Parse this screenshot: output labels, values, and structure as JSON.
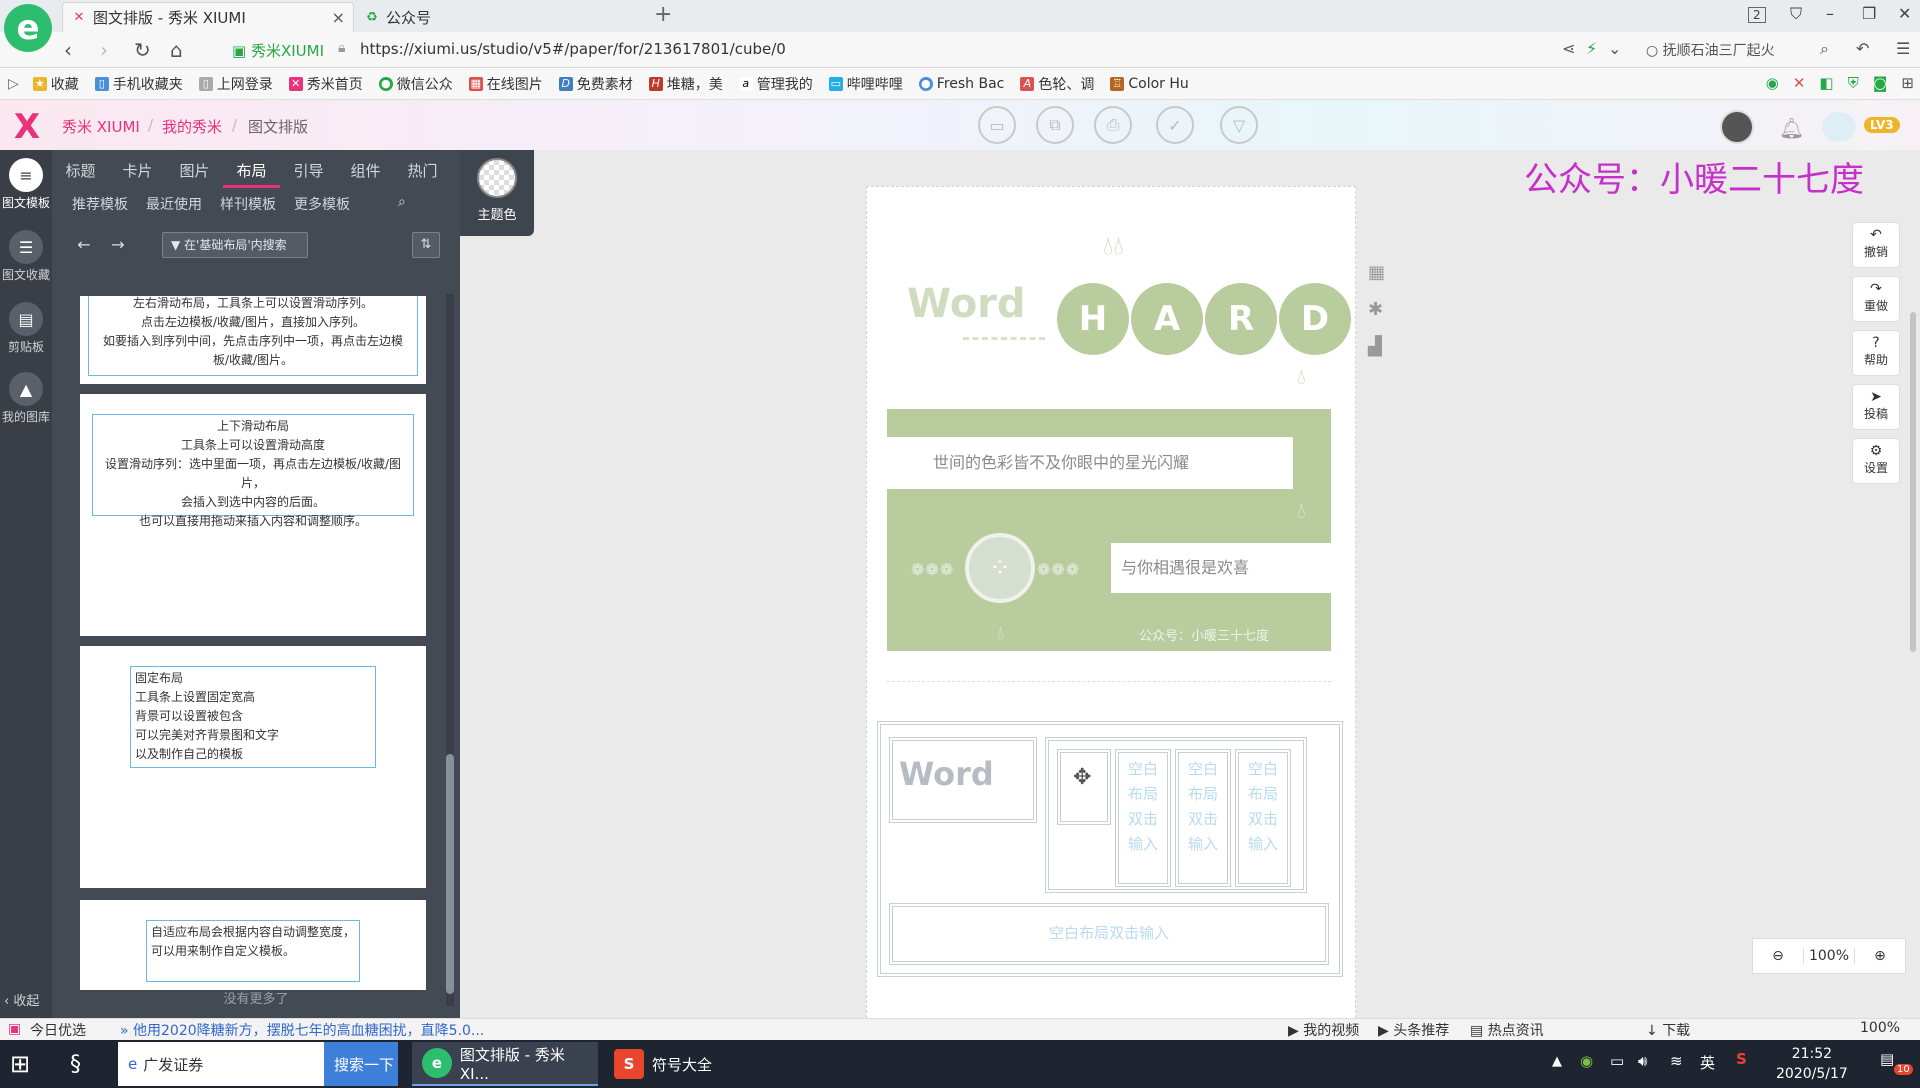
{
  "browser": {
    "logo": "e",
    "tabs": [
      {
        "title": "图文排版 - 秀米 XIUMI",
        "close": "×"
      },
      {
        "title": "公众号"
      }
    ],
    "new_tab": "+",
    "tab_count": "2",
    "site_name": "秀米XIUMI",
    "url": "https://xiumi.us/studio/v5#/paper/for/213617801/cube/0",
    "search_hint": "抚顺石油三厂起火",
    "bookmarks": [
      "收藏",
      "手机收藏夹",
      "上网登录",
      "秀米首页",
      "微信公众",
      "在线图片",
      "免费素材",
      "堆糖，美",
      "管理我的",
      "哔哩哔哩",
      "Fresh Bac",
      "色轮、调",
      "Color Hu"
    ]
  },
  "app": {
    "logo": "X",
    "breadcrumb": [
      "秀米 XIUMI",
      "我的秀米",
      "图文排版"
    ],
    "level": "LV3"
  },
  "leftnav": [
    {
      "label": "图文模板",
      "icon": "≡"
    },
    {
      "label": "图文收藏",
      "icon": "☰"
    },
    {
      "label": "剪贴板",
      "icon": "▤"
    },
    {
      "label": "我的图库",
      "icon": "▲"
    }
  ],
  "collapse_label": "收起",
  "panel": {
    "categories": [
      "标题",
      "卡片",
      "图片",
      "布局",
      "引导",
      "组件",
      "热门"
    ],
    "subtabs": [
      "推荐模板",
      "最近使用",
      "样刊模板",
      "更多模板"
    ],
    "search_placeholder": "在'基础布局'内搜索",
    "theme_label": "主题色",
    "templates": [
      {
        "lines": [
          "左右滑动布局，工具条上可以设置滑动序列。",
          "点击左边模板/收藏/图片，直接加入序列。",
          "如要插入到序列中间，先点击序列中一项，再点击左边模",
          "板/收藏/图片。"
        ]
      },
      {
        "lines": [
          "上下滑动布局",
          "工具条上可以设置滑动高度",
          "设置滑动序列：选中里面一项，再点击左边模板/收藏/图片，",
          "会插入到选中内容的后面。",
          "也可以直接用拖动来插入内容和调整顺序。"
        ]
      },
      {
        "lines": [
          "固定布局",
          "工具条上设置固定宽高",
          "背景可以设置被包含",
          "可以完美对齐背景图和文字",
          "以及制作自己的模板"
        ]
      },
      {
        "lines": [
          "自适应布局会根据内容自动调整宽度，",
          "可以用来制作自定义模板。"
        ]
      }
    ],
    "no_more": "没有更多了"
  },
  "canvas": {
    "watermark": "公众号：小暖二十七度",
    "block1": {
      "word": "Word",
      "hard": [
        "H",
        "A",
        "R",
        "D"
      ],
      "line1": "世间的色彩皆不及你眼中的星光闪耀",
      "line2": "与你相遇很是欢喜",
      "footer": "公众号：小暖三十七度"
    },
    "block2": {
      "word": "Word",
      "placeholder": [
        "空白",
        "布局",
        "双击",
        "输入"
      ],
      "bottom_placeholder": "空白布局双击输入"
    }
  },
  "right_tools": [
    {
      "label": "撤销",
      "icon": "↶"
    },
    {
      "label": "重做",
      "icon": "↷"
    },
    {
      "label": "帮助",
      "icon": "?"
    },
    {
      "label": "投稿",
      "icon": "➤"
    },
    {
      "label": "设置",
      "icon": "⚙"
    }
  ],
  "zoom": {
    "level": "100%"
  },
  "statusbar": {
    "left": "今日优选",
    "news": "他用2020降糖新方，摆脱七年的高血糖困扰，直降5.0...",
    "right": [
      "我的视频",
      "头条推荐",
      "热点资讯",
      "下载"
    ],
    "zoom": "100%"
  },
  "taskbar": {
    "items": [
      "广发证券",
      "搜索一下",
      "图文排版 - 秀米 XI...",
      "符号大全"
    ],
    "ime": "英",
    "time": "21:52",
    "date": "2020/5/17",
    "badge": "10"
  },
  "colors": {
    "accent": "#e8327c",
    "green": "#b8cc9e",
    "blue_border": "#6bb7e6",
    "watermark": "#c62fc9"
  }
}
